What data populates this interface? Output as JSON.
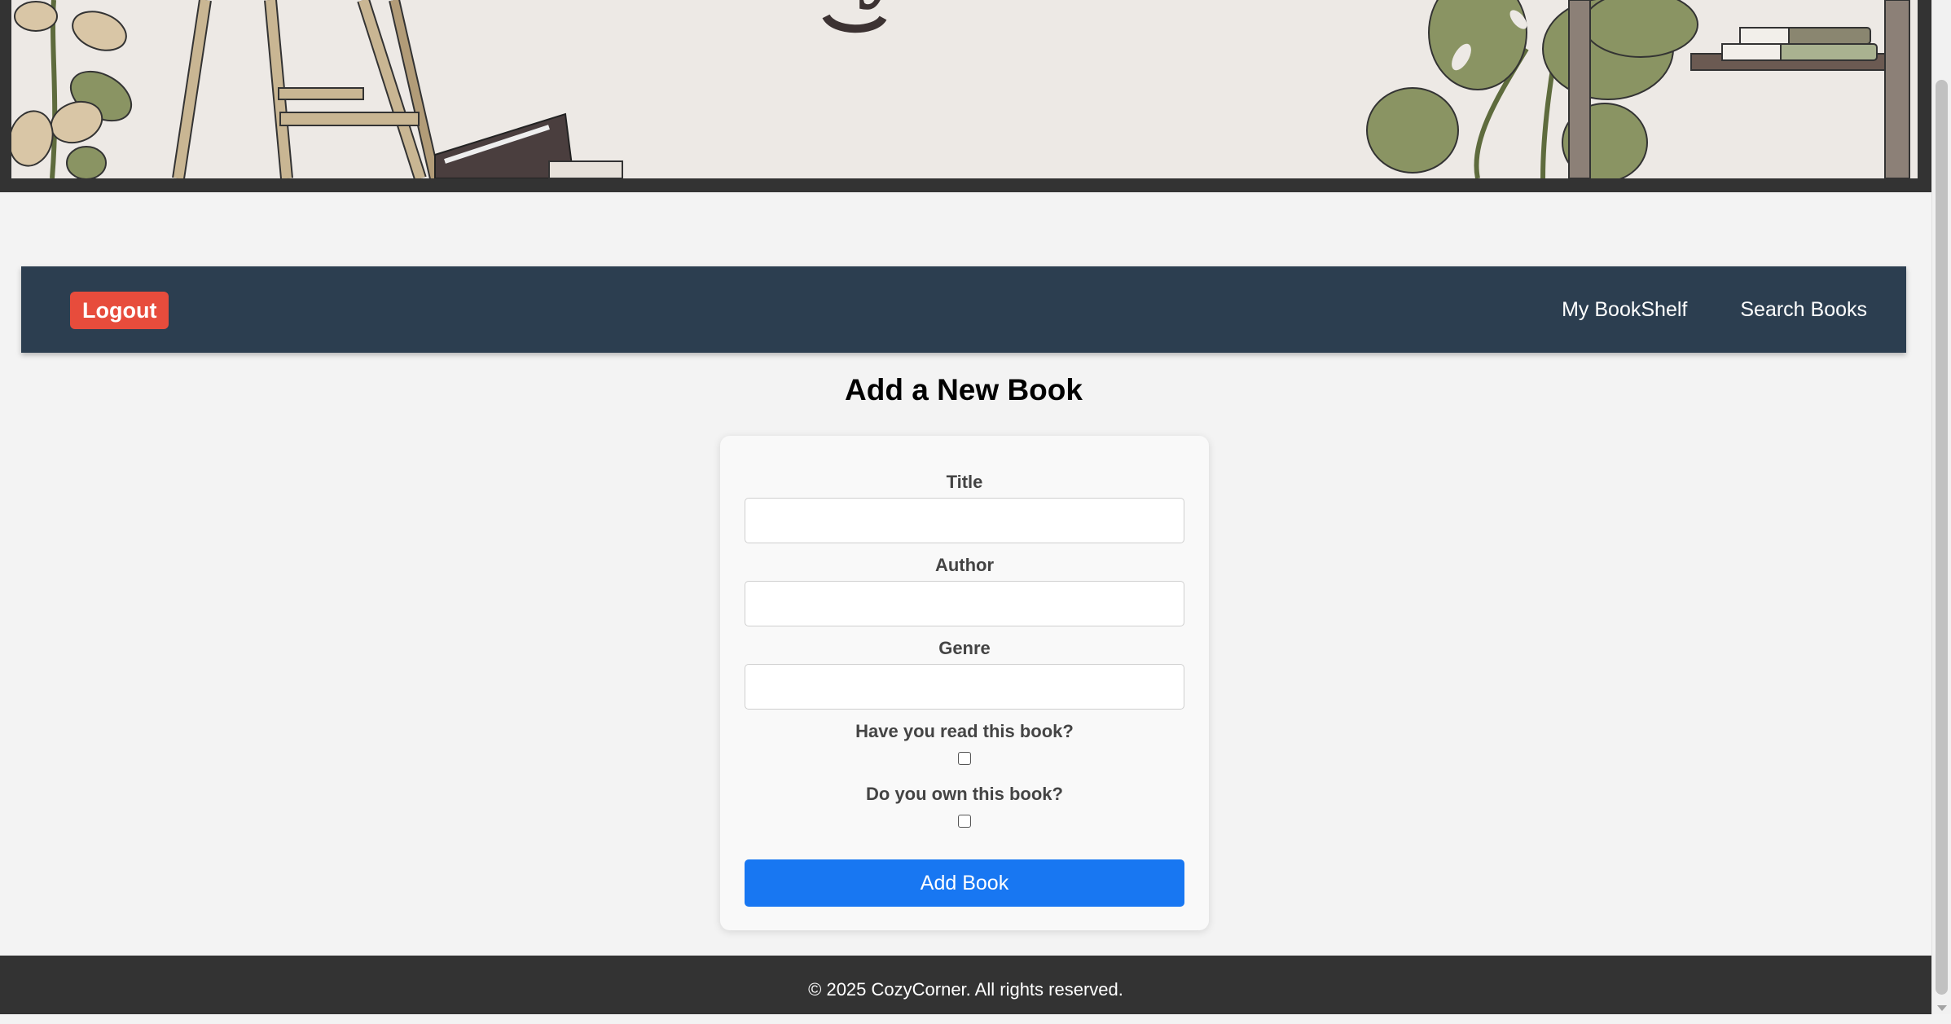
{
  "nav": {
    "logout_label": "Logout",
    "links": [
      {
        "label": "My BookShelf"
      },
      {
        "label": "Search Books"
      }
    ]
  },
  "page": {
    "title": "Add a New Book"
  },
  "form": {
    "title_label": "Title",
    "title_value": "",
    "author_label": "Author",
    "author_value": "",
    "genre_label": "Genre",
    "genre_value": "",
    "read_label": "Have you read this book?",
    "read_checked": false,
    "own_label": "Do you own this book?",
    "own_checked": false,
    "submit_label": "Add Book"
  },
  "footer": {
    "text": "© 2025 CozyCorner. All rights reserved."
  },
  "colors": {
    "navbar": "#2c3e50",
    "logout": "#e74c3c",
    "primary": "#1877f2",
    "footer": "#333333",
    "banner_bg": "#ede9e5",
    "plant": "#8a9463"
  }
}
